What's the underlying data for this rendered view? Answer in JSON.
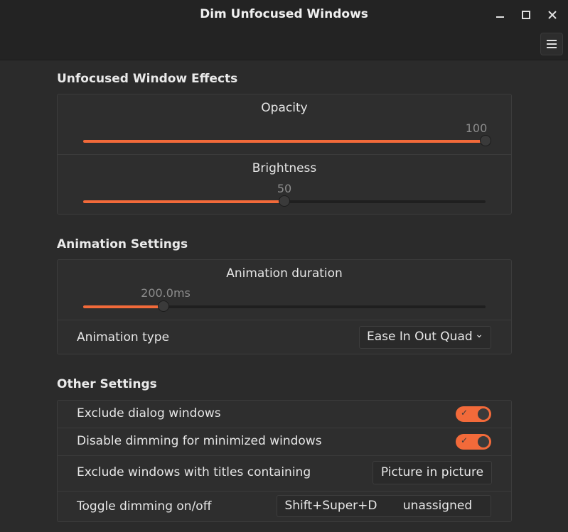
{
  "window": {
    "title": "Dim Unfocused Windows",
    "controls": [
      "minimize",
      "maximize",
      "close"
    ]
  },
  "sections": {
    "effects": {
      "title": "Unfocused Window Effects",
      "opacity": {
        "label": "Opacity",
        "value_text": "100",
        "level": 1.0
      },
      "brightness": {
        "label": "Brightness",
        "value_text": "50",
        "level": 0.5
      }
    },
    "animation": {
      "title": "Animation Settings",
      "duration": {
        "label": "Animation duration",
        "value_text": "200.0ms",
        "level": 0.2
      },
      "type": {
        "label": "Animation type",
        "selected": "Ease In Out Quad"
      }
    },
    "other": {
      "title": "Other Settings",
      "exclude_dialogs": {
        "label": "Exclude dialog windows",
        "enabled": true
      },
      "disable_minimized": {
        "label": "Disable dimming for minimized windows",
        "enabled": true
      },
      "exclude_titles": {
        "label": "Exclude windows with titles containing",
        "button": "Picture in picture"
      },
      "toggle_shortcut": {
        "label": "Toggle dimming on/off",
        "primary": "Shift+Super+D",
        "secondary": "unassigned"
      }
    }
  },
  "colors": {
    "accent": "#f26a3a",
    "background": "#2b2b2b",
    "titlebar": "#232323"
  },
  "icons": {
    "minimize": "minimize-icon",
    "maximize": "maximize-icon",
    "close": "close-icon",
    "menu": "hamburger-menu-icon"
  }
}
